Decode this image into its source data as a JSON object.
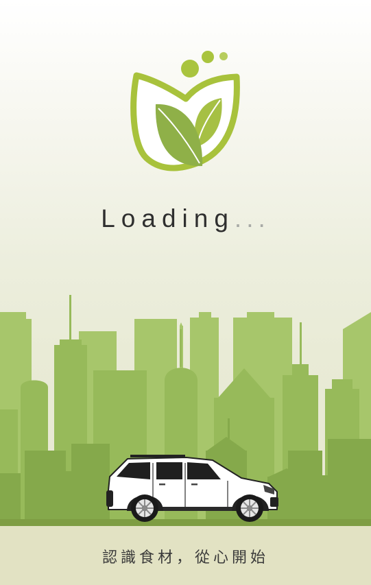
{
  "loading": {
    "text": "Loading",
    "dots": "..."
  },
  "tagline": "認識食材，從心開始",
  "logo": {
    "name": "leaf-logo"
  },
  "colors": {
    "leaf_light": "#a9c43e",
    "leaf_dark": "#8db04a",
    "city_light": "#a6c56a",
    "city_mid": "#95b957",
    "city_dark": "#7fa446",
    "ground": "#7e9d43",
    "bottom_band": "#e2e2c3"
  }
}
